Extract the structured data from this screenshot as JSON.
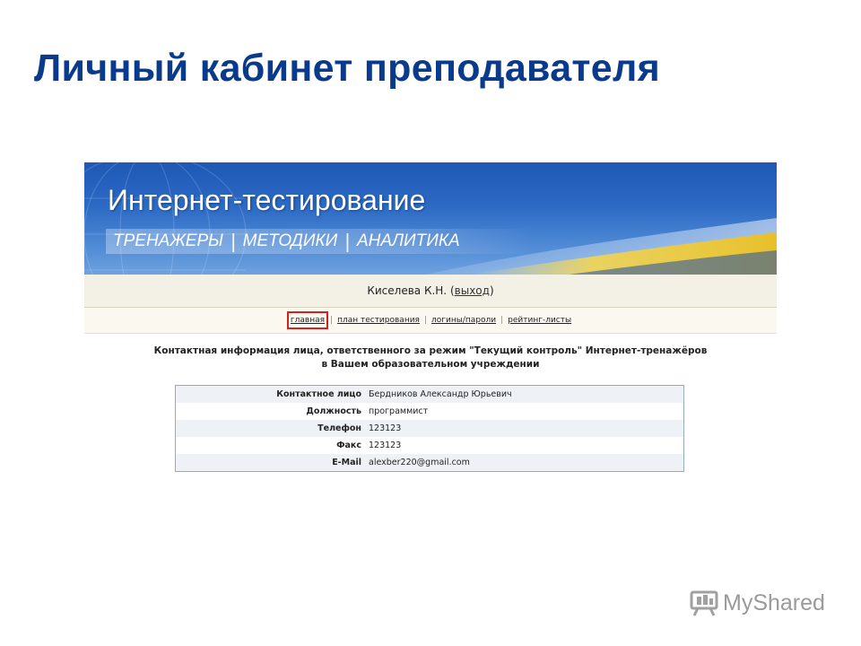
{
  "slide": {
    "title": "Личный кабинет преподавателя"
  },
  "banner": {
    "title": "Интернет-тестирование",
    "menu": [
      "ТРЕНАЖЕРЫ",
      "МЕТОДИКИ",
      "АНАЛИТИКА"
    ]
  },
  "user": {
    "name": "Киселева К.Н.",
    "logout": "выход"
  },
  "nav": {
    "items": [
      "главная",
      "план тестирования",
      "логины/пароли",
      "рейтинг-листы"
    ],
    "active": "главная",
    "separator": "|"
  },
  "contact": {
    "heading_line1": "Контактная информация лица, ответственного за режим \"Текущий контроль\" Интернет-тренажёров",
    "heading_line2": "в Вашем образовательном учреждении",
    "rows": [
      {
        "label": "Контактное лицо",
        "value": "Бердников Александр Юрьевич"
      },
      {
        "label": "Должность",
        "value": "программист"
      },
      {
        "label": "Телефон",
        "value": "123123"
      },
      {
        "label": "Факс",
        "value": "123123"
      },
      {
        "label": "E-Mail",
        "value": "alexber220@gmail.com"
      }
    ]
  },
  "watermark": {
    "text": "MyShared",
    "icon": "myshared-logo-icon"
  },
  "colors": {
    "title": "#0a3a8c",
    "banner": "#2c6ac4",
    "accent": "#f2d24a",
    "active_outline": "#d42020"
  }
}
